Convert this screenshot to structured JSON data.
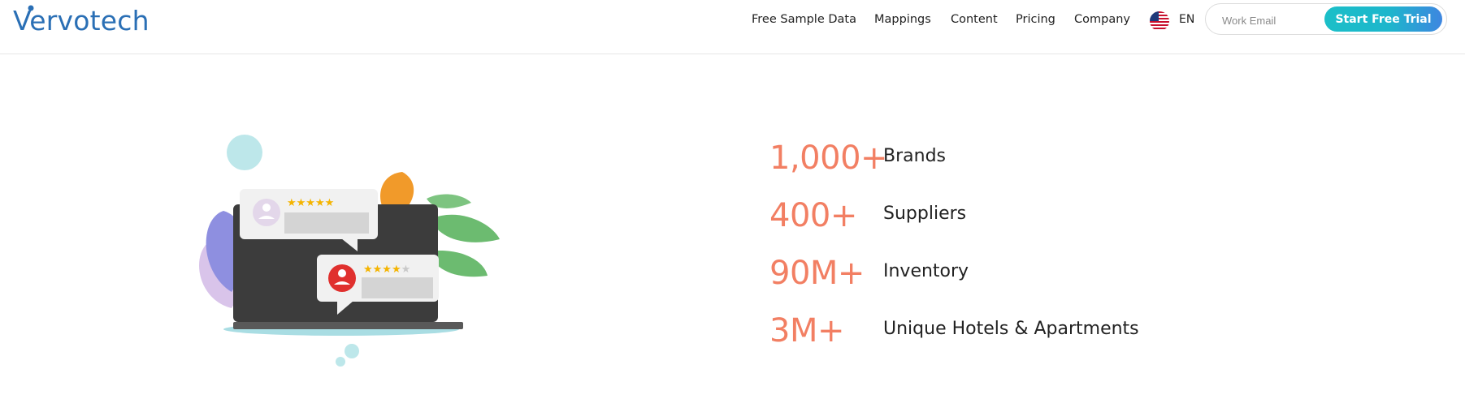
{
  "brand": {
    "name": "Vervotech"
  },
  "nav": {
    "items": [
      {
        "label": "Free Sample Data"
      },
      {
        "label": "Mappings"
      },
      {
        "label": "Content"
      },
      {
        "label": "Pricing"
      },
      {
        "label": "Company"
      }
    ],
    "language": "EN"
  },
  "signup": {
    "email_placeholder": "Work Email",
    "cta_label": "Start Free Trial"
  },
  "stats": [
    {
      "value": "1,000+",
      "label": "Brands"
    },
    {
      "value": "400+",
      "label": "Suppliers"
    },
    {
      "value": "90M+",
      "label": "Inventory"
    },
    {
      "value": "3M+",
      "label": "Unique Hotels & Apartments"
    }
  ],
  "reviews": [
    {
      "rating": 5,
      "max": 5
    },
    {
      "rating": 4,
      "max": 5
    }
  ],
  "colors": {
    "brand_blue": "#2a6fb5",
    "stat_accent": "#f27f63",
    "cta_start": "#1bbfc8",
    "cta_end": "#3e86e0"
  }
}
